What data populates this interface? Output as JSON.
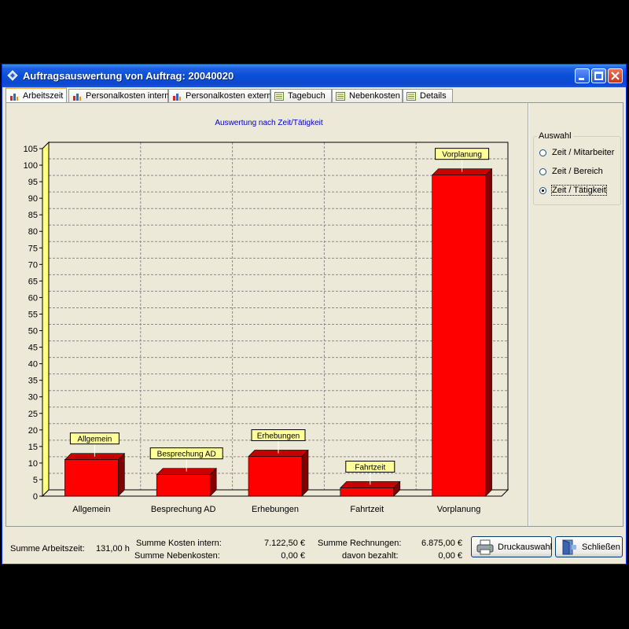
{
  "window": {
    "title": "Auftragsauswertung von Auftrag: 20040020"
  },
  "tabs": [
    {
      "label": "Arbeitszeit",
      "icon": "bar-chart-icon",
      "active": true
    },
    {
      "label": "Personalkosten intern",
      "icon": "bar-chart-icon",
      "active": false
    },
    {
      "label": "Personalkosten extern",
      "icon": "bar-chart-icon",
      "active": false
    },
    {
      "label": "Tagebuch",
      "icon": "list-icon",
      "active": false
    },
    {
      "label": "Nebenkosten",
      "icon": "list-icon",
      "active": false
    },
    {
      "label": "Details",
      "icon": "list-icon",
      "active": false
    }
  ],
  "chart_data": {
    "type": "bar",
    "title": "Auswertung nach Zeit/Tätigkeit",
    "categories": [
      "Allgemein",
      "Besprechung AD",
      "Erhebungen",
      "Fahrtzeit",
      "Vorplanung"
    ],
    "values": [
      11,
      6.5,
      12,
      2.5,
      97
    ],
    "data_labels": [
      "Allgemein",
      "Besprechung AD",
      "Erhebungen",
      "Fahrtzeit",
      "Vorplanung"
    ],
    "ylim": [
      0,
      105
    ],
    "yticks": [
      0,
      5,
      10,
      15,
      20,
      25,
      30,
      35,
      40,
      45,
      50,
      55,
      60,
      65,
      70,
      75,
      80,
      85,
      90,
      95,
      100,
      105
    ],
    "grid": true,
    "colors": {
      "bar": "#ff0000",
      "bar_top": "#c80000",
      "bar_side": "#800000",
      "wall": "#ffff80",
      "label_bg": "#ffff99",
      "title": "#0000cc"
    }
  },
  "selection": {
    "title": "Auswahl",
    "options": [
      {
        "label": "Zeit / Mitarbeiter",
        "selected": false
      },
      {
        "label": "Zeit / Bereich",
        "selected": false
      },
      {
        "label": "Zeit / Tätigkeit",
        "selected": true
      }
    ]
  },
  "footer": {
    "arbeitszeit_label": "Summe Arbeitszeit:",
    "arbeitszeit_value": "131,00 h",
    "kosten_intern_label": "Summe Kosten intern:",
    "kosten_intern_value": "7.122,50 €",
    "nebenkosten_label": "Summe Nebenkosten:",
    "nebenkosten_value": "0,00 €",
    "rechnungen_label": "Summe Rechnungen:",
    "rechnungen_value": "6.875,00 €",
    "bezahlt_label": "davon bezahlt:",
    "bezahlt_value": "0,00 €"
  },
  "buttons": {
    "print_label": "Druckauswahl",
    "close_label": "Schließen"
  }
}
